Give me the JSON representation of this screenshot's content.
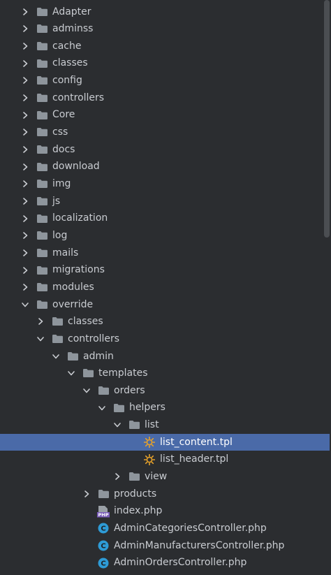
{
  "colors": {
    "background": "#2b2d30",
    "text": "#c9ccd1",
    "selection": "#4a6aa8",
    "folder": "#8e959c",
    "php_class": "#2e9bd6",
    "php_file": "#7a5cb8",
    "tpl_icon": "#e6a12a"
  },
  "tree": [
    {
      "label": "Adapter",
      "depth": 0,
      "type": "folder",
      "state": "collapsed",
      "icon": "folder-icon"
    },
    {
      "label": "adminss",
      "depth": 0,
      "type": "folder",
      "state": "collapsed",
      "icon": "folder-icon"
    },
    {
      "label": "cache",
      "depth": 0,
      "type": "folder",
      "state": "collapsed",
      "icon": "folder-icon"
    },
    {
      "label": "classes",
      "depth": 0,
      "type": "folder",
      "state": "collapsed",
      "icon": "folder-icon"
    },
    {
      "label": "config",
      "depth": 0,
      "type": "folder",
      "state": "collapsed",
      "icon": "folder-icon"
    },
    {
      "label": "controllers",
      "depth": 0,
      "type": "folder",
      "state": "collapsed",
      "icon": "folder-icon"
    },
    {
      "label": "Core",
      "depth": 0,
      "type": "folder",
      "state": "collapsed",
      "icon": "folder-icon"
    },
    {
      "label": "css",
      "depth": 0,
      "type": "folder",
      "state": "collapsed",
      "icon": "folder-icon"
    },
    {
      "label": "docs",
      "depth": 0,
      "type": "folder",
      "state": "collapsed",
      "icon": "folder-icon"
    },
    {
      "label": "download",
      "depth": 0,
      "type": "folder",
      "state": "collapsed",
      "icon": "folder-icon"
    },
    {
      "label": "img",
      "depth": 0,
      "type": "folder",
      "state": "collapsed",
      "icon": "folder-icon"
    },
    {
      "label": "js",
      "depth": 0,
      "type": "folder",
      "state": "collapsed",
      "icon": "folder-icon"
    },
    {
      "label": "localization",
      "depth": 0,
      "type": "folder",
      "state": "collapsed",
      "icon": "folder-icon"
    },
    {
      "label": "log",
      "depth": 0,
      "type": "folder",
      "state": "collapsed",
      "icon": "folder-icon"
    },
    {
      "label": "mails",
      "depth": 0,
      "type": "folder",
      "state": "collapsed",
      "icon": "folder-icon"
    },
    {
      "label": "migrations",
      "depth": 0,
      "type": "folder",
      "state": "collapsed",
      "icon": "folder-icon"
    },
    {
      "label": "modules",
      "depth": 0,
      "type": "folder",
      "state": "collapsed",
      "icon": "folder-icon"
    },
    {
      "label": "override",
      "depth": 0,
      "type": "folder",
      "state": "expanded",
      "icon": "folder-icon"
    },
    {
      "label": "classes",
      "depth": 1,
      "type": "folder",
      "state": "collapsed",
      "icon": "folder-icon"
    },
    {
      "label": "controllers",
      "depth": 1,
      "type": "folder",
      "state": "expanded",
      "icon": "folder-icon"
    },
    {
      "label": "admin",
      "depth": 2,
      "type": "folder",
      "state": "expanded",
      "icon": "folder-icon"
    },
    {
      "label": "templates",
      "depth": 3,
      "type": "folder",
      "state": "expanded",
      "icon": "folder-icon"
    },
    {
      "label": "orders",
      "depth": 4,
      "type": "folder",
      "state": "expanded",
      "icon": "folder-icon"
    },
    {
      "label": "helpers",
      "depth": 5,
      "type": "folder",
      "state": "expanded",
      "icon": "folder-icon"
    },
    {
      "label": "list",
      "depth": 6,
      "type": "folder",
      "state": "expanded",
      "icon": "folder-icon"
    },
    {
      "label": "list_content.tpl",
      "depth": 7,
      "type": "tpl",
      "state": "none",
      "icon": "template-file-icon",
      "selected": true
    },
    {
      "label": "list_header.tpl",
      "depth": 7,
      "type": "tpl",
      "state": "none",
      "icon": "template-file-icon"
    },
    {
      "label": "view",
      "depth": 6,
      "type": "folder",
      "state": "collapsed",
      "icon": "folder-icon"
    },
    {
      "label": "products",
      "depth": 4,
      "type": "folder",
      "state": "collapsed",
      "icon": "folder-icon"
    },
    {
      "label": "index.php",
      "depth": 4,
      "type": "php",
      "state": "none",
      "icon": "php-file-icon",
      "icon_text": "PHP"
    },
    {
      "label": "AdminCategoriesController.php",
      "depth": 4,
      "type": "class",
      "state": "none",
      "icon": "php-class-icon",
      "icon_text": "C"
    },
    {
      "label": "AdminManufacturersController.php",
      "depth": 4,
      "type": "class",
      "state": "none",
      "icon": "php-class-icon",
      "icon_text": "C"
    },
    {
      "label": "AdminOrdersController.php",
      "depth": 4,
      "type": "class",
      "state": "none",
      "icon": "php-class-icon",
      "icon_text": "C"
    }
  ]
}
